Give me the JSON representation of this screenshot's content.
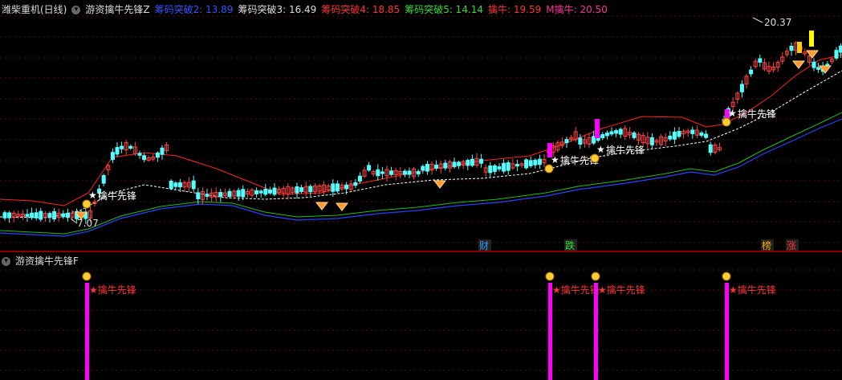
{
  "main": {
    "title": "潍柴重机(日线)",
    "indicator": "游资擒牛先锋Z",
    "params": [
      {
        "label": "筹码突破2:",
        "value": "13.89",
        "color": "#3355ff"
      },
      {
        "label": "筹码突破3:",
        "value": "16.49",
        "color": "#dddddd"
      },
      {
        "label": "筹码突破4:",
        "value": "18.85",
        "color": "#ff3333"
      },
      {
        "label": "筹码突破5:",
        "value": "14.14",
        "color": "#33dd33"
      },
      {
        "label": "擒牛:",
        "value": "19.59",
        "color": "#ff3333"
      },
      {
        "label": "M擒牛:",
        "value": "20.50",
        "color": "#ff3399"
      }
    ],
    "price_high": "20.37",
    "price_low": "7.07",
    "signal_label": "擒牛先锋",
    "event_tags": [
      "财",
      "跌",
      "榜",
      "涨"
    ]
  },
  "sub": {
    "indicator": "游资擒牛先锋F",
    "signal_label": "★擒牛先锋"
  },
  "colors": {
    "background": "#000000",
    "up": "#ff4444",
    "down": "#54ffff",
    "red_band": "#ff2222",
    "green_band": "#22bb22",
    "blue_band": "#2244ff",
    "mid_line": "#ffffff",
    "signal_bar": "#ff00ff"
  }
}
